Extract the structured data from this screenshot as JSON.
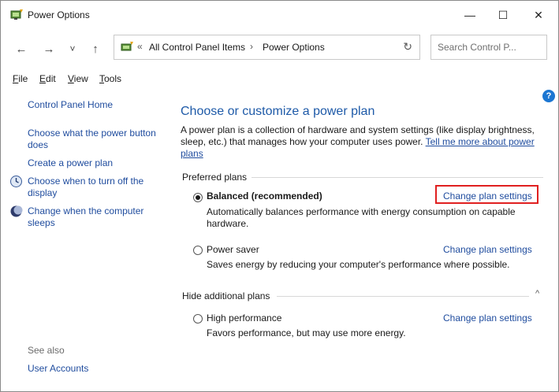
{
  "window": {
    "title": "Power Options",
    "minimize": "—",
    "maximize": "☐",
    "close": "✕"
  },
  "nav": {
    "back": "←",
    "forward": "→",
    "recent": "˅",
    "up": "↑",
    "refresh": "↻",
    "address_chevrons": "«",
    "breadcrumbs": [
      "All Control Panel Items",
      "Power Options"
    ],
    "crumb_separator": "›",
    "search_placeholder": "Search Control P..."
  },
  "menu": {
    "items": [
      {
        "key": "F",
        "rest": "ile"
      },
      {
        "key": "E",
        "rest": "dit"
      },
      {
        "key": "V",
        "rest": "iew"
      },
      {
        "key": "T",
        "rest": "ools"
      }
    ]
  },
  "sidebar": {
    "home": "Control Panel Home",
    "links": [
      "Choose what the power button does",
      "Create a power plan",
      "Choose when to turn off the display",
      "Change when the computer sleeps"
    ],
    "see_also_label": "See also",
    "see_also_links": [
      "User Accounts"
    ]
  },
  "main": {
    "heading": "Choose or customize a power plan",
    "intro_text": "A power plan is a collection of hardware and system settings (like display brightness, sleep, etc.) that manages how your computer uses power.",
    "intro_link": "Tell me more about power plans",
    "preferred_label": "Preferred plans",
    "hidden_label": "Hide additional plans",
    "help": "?",
    "collapse": "^",
    "plans": [
      {
        "name": "Balanced (recommended)",
        "description": "Automatically balances performance with energy consumption on capable hardware.",
        "link": "Change plan settings",
        "selected": true
      },
      {
        "name": "Power saver",
        "description": "Saves energy by reducing your computer's performance where possible.",
        "link": "Change plan settings",
        "selected": false
      },
      {
        "name": "High performance",
        "description": "Favors performance, but may use more energy.",
        "link": "Change plan settings",
        "selected": false
      }
    ]
  },
  "colors": {
    "link": "#1f4c9e",
    "heading": "#1e5aa8",
    "highlight_box": "#e02020"
  }
}
